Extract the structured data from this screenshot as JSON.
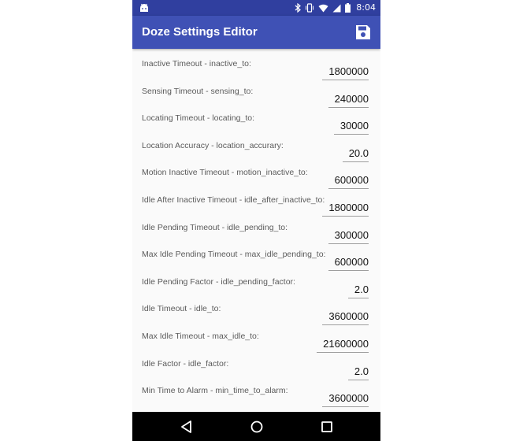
{
  "status_bar": {
    "time": "8:04",
    "left_icon": "android-notification-icon",
    "icons": [
      "bluetooth-icon",
      "vibrate-icon",
      "wifi-icon",
      "signal-icon",
      "battery-icon"
    ]
  },
  "toolbar": {
    "title": "Doze Settings Editor",
    "save_icon": "save-icon",
    "color": "#3f51b5",
    "status_color": "#303f9f"
  },
  "settings": [
    {
      "label": "Inactive Timeout - inactive_to:",
      "value": "1800000"
    },
    {
      "label": "Sensing Timeout - sensing_to:",
      "value": "240000"
    },
    {
      "label": "Locating Timeout - locating_to:",
      "value": "30000"
    },
    {
      "label": "Location Accuracy - location_accurary:",
      "value": "20.0"
    },
    {
      "label": "Motion Inactive Timeout - motion_inactive_to:",
      "value": "600000"
    },
    {
      "label": "Idle After Inactive Timeout - idle_after_inactive_to:",
      "value": "1800000"
    },
    {
      "label": "Idle Pending Timeout - idle_pending_to:",
      "value": "300000"
    },
    {
      "label": "Max Idle Pending Timeout - max_idle_pending_to:",
      "value": "600000"
    },
    {
      "label": "Idle Pending Factor - idle_pending_factor:",
      "value": "2.0"
    },
    {
      "label": "Idle Timeout - idle_to:",
      "value": "3600000"
    },
    {
      "label": "Max Idle Timeout - max_idle_to:",
      "value": "21600000"
    },
    {
      "label": "Idle Factor - idle_factor:",
      "value": "2.0"
    },
    {
      "label": "Min Time to Alarm - min_time_to_alarm:",
      "value": "3600000"
    }
  ],
  "nav_bar": {
    "back_icon": "back-triangle-icon",
    "home_icon": "home-circle-icon",
    "recents_icon": "recents-square-icon"
  }
}
